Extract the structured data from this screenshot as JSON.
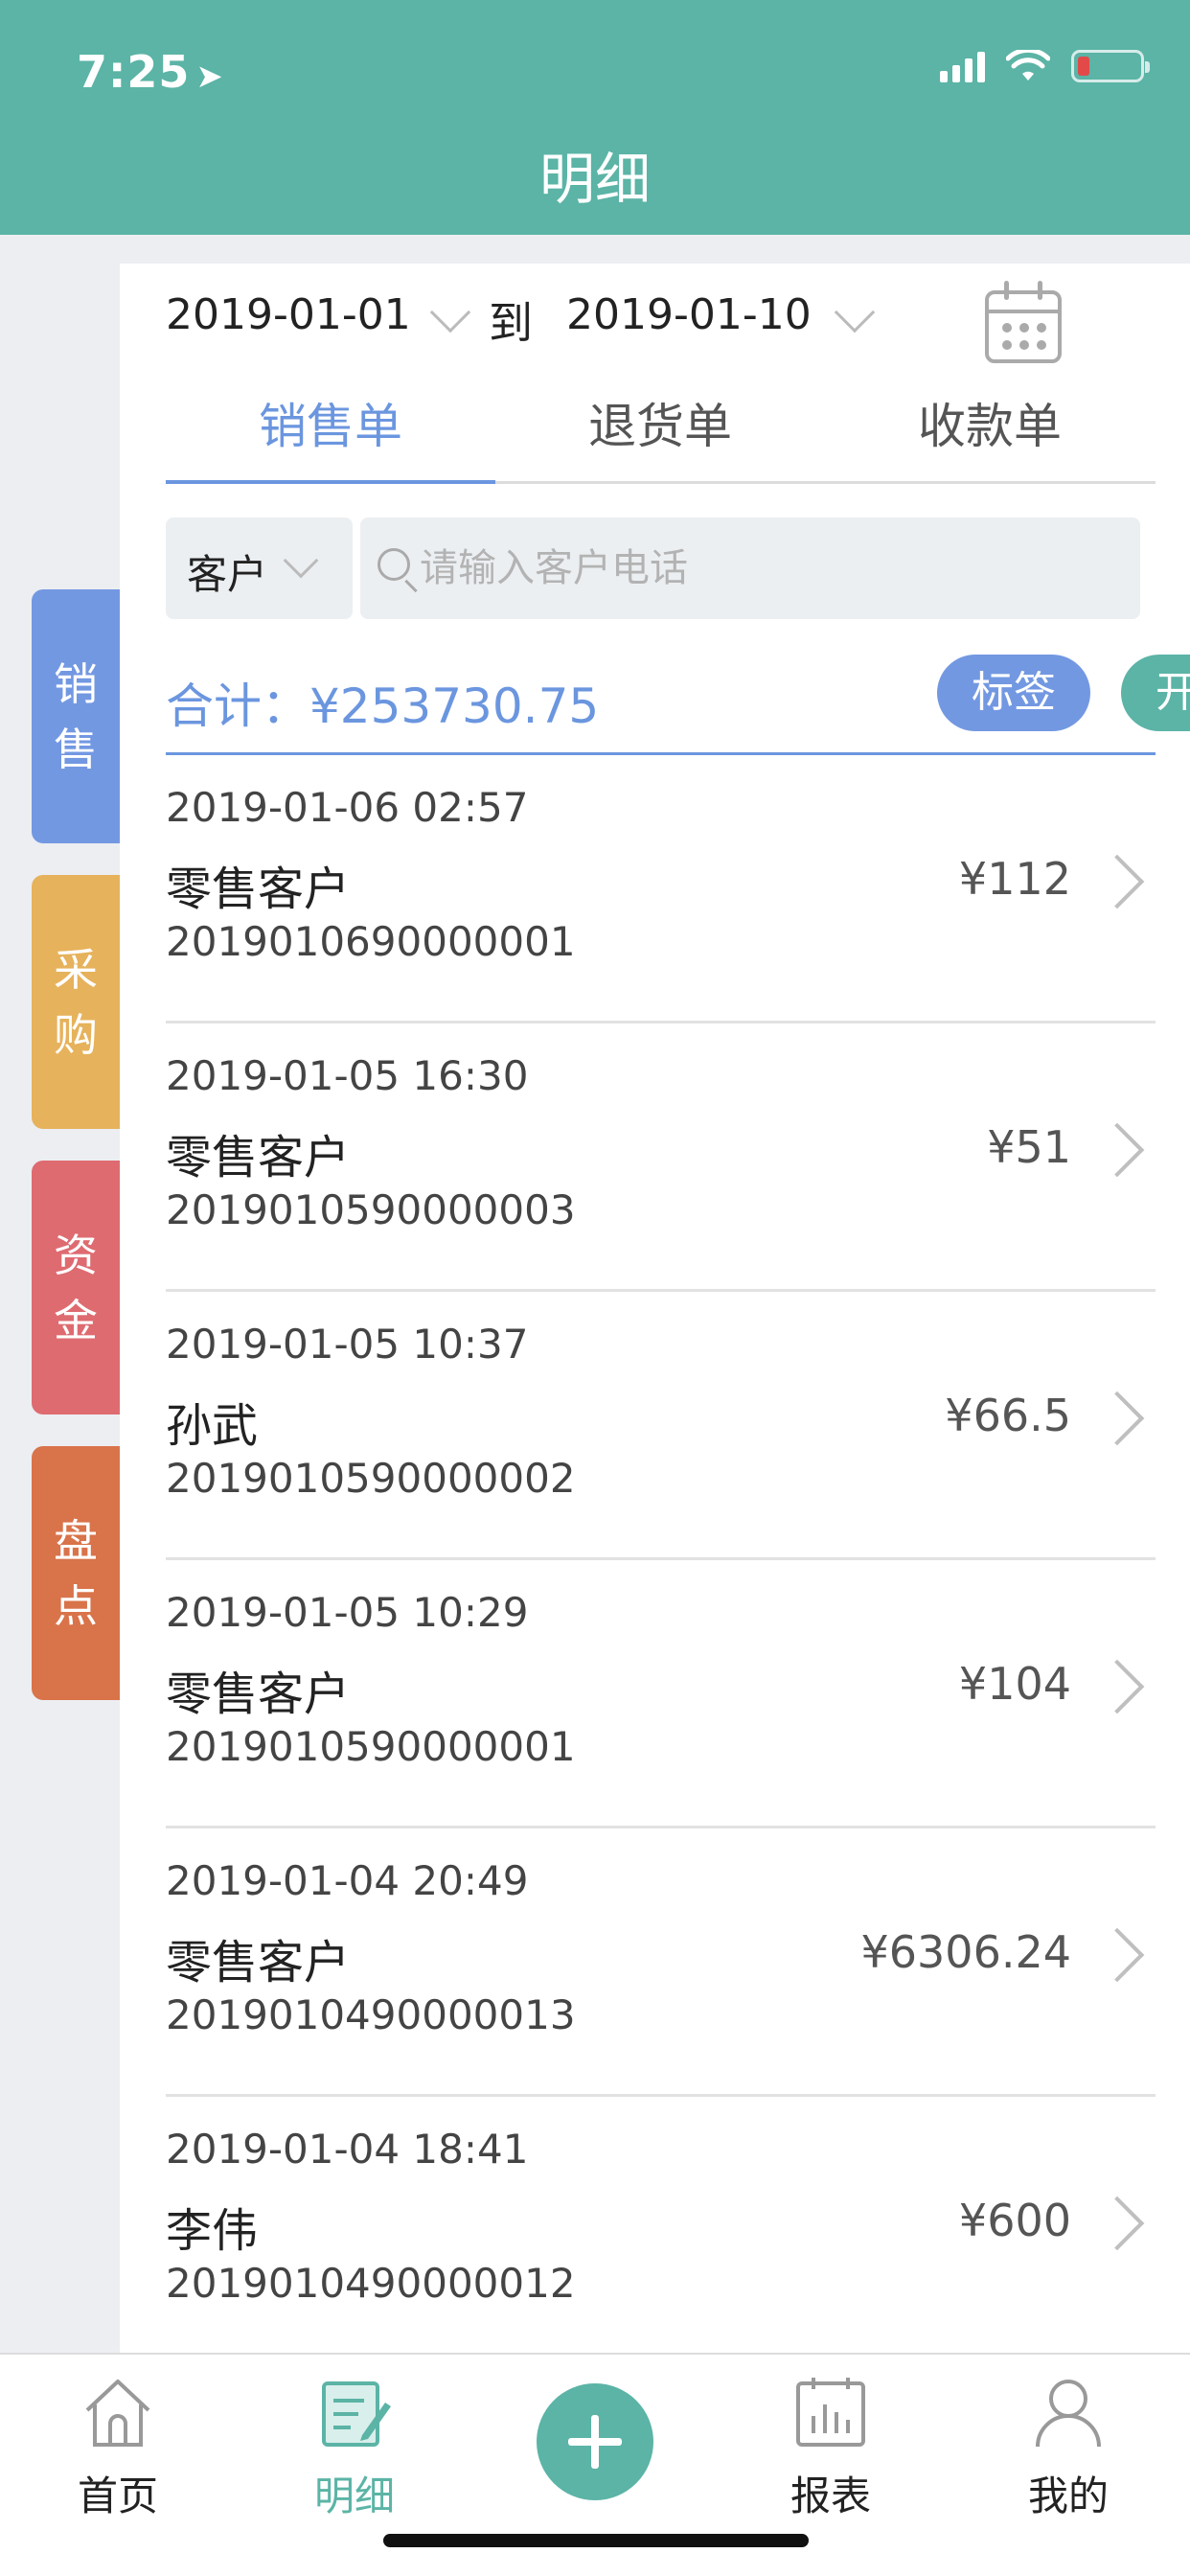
{
  "status": {
    "time": "7:25"
  },
  "header": {
    "title": "明细"
  },
  "side_tabs": [
    {
      "label": "销售",
      "color": "#7398e2"
    },
    {
      "label": "采购",
      "color": "#e6b25b"
    },
    {
      "label": "资金",
      "color": "#de6b70"
    },
    {
      "label": "盘点",
      "color": "#d9734a"
    }
  ],
  "date_range": {
    "start": "2019-01-01",
    "to_label": "到",
    "end": "2019-01-10"
  },
  "tabs": [
    {
      "label": "销售单"
    },
    {
      "label": "退货单"
    },
    {
      "label": "收款单"
    }
  ],
  "filter": {
    "customer_label": "客户",
    "search_placeholder": "请输入客户电话"
  },
  "summary": {
    "total_label": "合计：",
    "total_value": "¥253730.75",
    "tag_button": "标签",
    "open_button": "开单"
  },
  "records": [
    {
      "datetime": "2019-01-06 02:57",
      "customer": "零售客户",
      "order_no": "2019010690000001",
      "amount": "¥112"
    },
    {
      "datetime": "2019-01-05 16:30",
      "customer": "零售客户",
      "order_no": "2019010590000003",
      "amount": "¥51"
    },
    {
      "datetime": "2019-01-05 10:37",
      "customer": "孙武",
      "order_no": "2019010590000002",
      "amount": "¥66.5"
    },
    {
      "datetime": "2019-01-05 10:29",
      "customer": "零售客户",
      "order_no": "2019010590000001",
      "amount": "¥104"
    },
    {
      "datetime": "2019-01-04 20:49",
      "customer": "零售客户",
      "order_no": "2019010490000013",
      "amount": "¥6306.24"
    },
    {
      "datetime": "2019-01-04 18:41",
      "customer": "李伟",
      "order_no": "2019010490000012",
      "amount": "¥600"
    }
  ],
  "nav": [
    {
      "label": "首页",
      "icon": "home-icon"
    },
    {
      "label": "明细",
      "icon": "detail-icon"
    },
    {
      "label": "报表",
      "icon": "report-icon"
    },
    {
      "label": "我的",
      "icon": "profile-icon"
    }
  ],
  "colors": {
    "primary": "#5bb4a6",
    "accent_blue": "#6b96df"
  }
}
